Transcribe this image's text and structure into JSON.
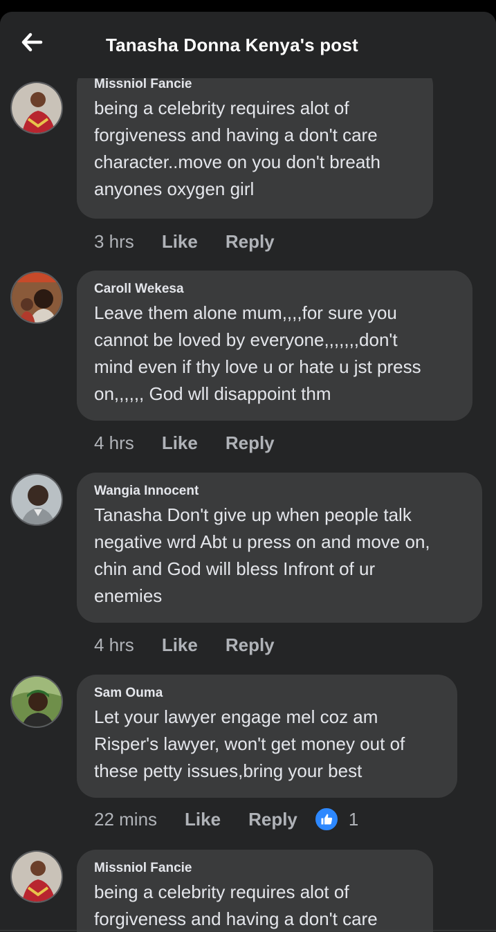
{
  "header": {
    "title": "Tanasha Donna Kenya's post",
    "back_icon": "arrow-left-icon"
  },
  "comments": [
    {
      "author": "Missniol Fancie",
      "lines": [
        "being a celebrity requires alot of",
        "forgiveness and having a don't care",
        "character..move on you don't breath",
        "anyones oxygen girl"
      ],
      "time": "3 hrs",
      "like": "Like",
      "reply": "Reply"
    },
    {
      "author": "Caroll Wekesa",
      "lines": [
        "Leave them alone mum,,,,for sure you",
        "cannot be loved by everyone,,,,,,,don't",
        "mind even if thy love u or hate u jst press",
        "on,,,,,, God wll disappoint thm"
      ],
      "time": "4 hrs",
      "like": "Like",
      "reply": "Reply"
    },
    {
      "author": "Wangia Innocent",
      "lines": [
        "Tanasha Don't give up when people talk",
        "negative wrd Abt u press on and move on,",
        "chin and God will bless Infront of ur",
        "enemies"
      ],
      "time": "4 hrs",
      "like": "Like",
      "reply": "Reply"
    },
    {
      "author": "Sam Ouma",
      "lines": [
        "Let your lawyer engage mel coz am",
        "Risper's lawyer, won't get money out of",
        "these petty issues,bring your best"
      ],
      "time": "22 mins",
      "like": "Like",
      "reply": "Reply",
      "reaction_count": "1",
      "reaction_icon": "thumbs-up-icon"
    },
    {
      "author": "Missniol Fancie",
      "lines": [
        "being a celebrity requires alot of",
        "forgiveness and having a don't care"
      ],
      "time": "",
      "like": "",
      "reply": ""
    }
  ],
  "colors": {
    "background": "#242526",
    "bubble": "#3a3b3c",
    "text": "#e4e6eb",
    "muted": "#b0b3b8",
    "like_blue": "#2d88ff"
  }
}
